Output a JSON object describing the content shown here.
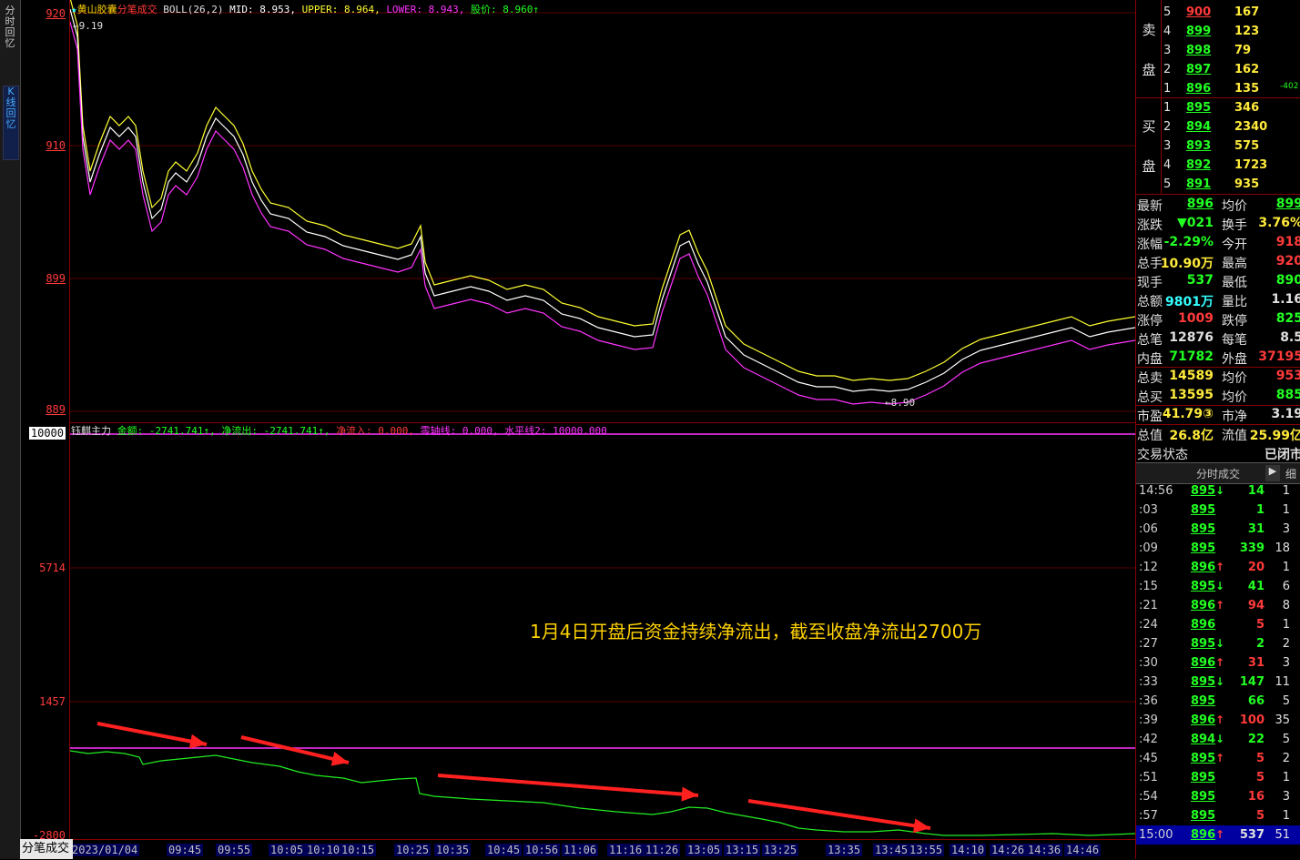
{
  "sidebar_tabs": [
    "分时回忆",
    "K线回忆"
  ],
  "upper_chart": {
    "legend": {
      "star": "★",
      "stock_name": "黄山胶囊",
      "mode": "分笔成交",
      "boll": "BOLL(26,2)",
      "mid": "MID: 8.953,",
      "upper": "UPPER: 8.964,",
      "lower": "LOWER: 8.943,",
      "price": "股价: 8.960↑"
    },
    "y_labels": [
      "920",
      "910",
      "899",
      "889"
    ],
    "high_mark": "9.19",
    "low_mark": "8.90"
  },
  "lower_chart": {
    "legend": {
      "name": "钰麒主力",
      "amount": "金额: -2741.741↑,",
      "net_out": "净流出: -2741.741↑,",
      "net_in": "净流入: 0.000,",
      "zero_line": "零轴线: 0.000,",
      "level2": "水平线2: 10000.000"
    },
    "y_labels": [
      "10000",
      "5714",
      "1457",
      "-2800"
    ],
    "annotation": "1月4日开盘后资金持续净流出，截至收盘净流出2700万"
  },
  "time_axis": [
    "2023/01/04",
    "09:45",
    "09:55",
    "10:05",
    "10:10",
    "10:15",
    "10:25",
    "10:35",
    "10:45",
    "10:56",
    "11:06",
    "11:16",
    "11:26",
    "13:05",
    "13:15",
    "13:25",
    "13:35",
    "13:45",
    "13:55",
    "14:10",
    "14:26",
    "14:36",
    "14:46"
  ],
  "bottom_tab": "分笔成交",
  "order_book": {
    "sell_label": [
      "卖",
      "盘"
    ],
    "buy_label": [
      "买",
      "盘"
    ],
    "sell": [
      {
        "lvl": "5",
        "price": "900",
        "vol": "167",
        "pc": "red"
      },
      {
        "lvl": "4",
        "price": "899",
        "vol": "123",
        "pc": "green"
      },
      {
        "lvl": "3",
        "price": "898",
        "vol": "79",
        "pc": "green"
      },
      {
        "lvl": "2",
        "price": "897",
        "vol": "162",
        "pc": "green"
      },
      {
        "lvl": "1",
        "price": "896",
        "vol": "135",
        "pc": "green",
        "delta": "-402"
      }
    ],
    "buy": [
      {
        "lvl": "1",
        "price": "895",
        "vol": "346",
        "pc": "green"
      },
      {
        "lvl": "2",
        "price": "894",
        "vol": "2340",
        "pc": "green"
      },
      {
        "lvl": "3",
        "price": "893",
        "vol": "575",
        "pc": "green"
      },
      {
        "lvl": "4",
        "price": "892",
        "vol": "1723",
        "pc": "green"
      },
      {
        "lvl": "5",
        "price": "891",
        "vol": "935",
        "pc": "green"
      }
    ]
  },
  "quote": [
    {
      "l": "最新",
      "v": "896",
      "vc": "green",
      "u": true,
      "l2": "均价",
      "v2": "899",
      "v2c": "green",
      "u2": true
    },
    {
      "l": "涨跌",
      "v": "▼021",
      "vc": "green",
      "l2": "换手",
      "v2": "3.76%",
      "v2c": "yellow"
    },
    {
      "l": "涨幅",
      "v": "-2.29%",
      "vc": "green",
      "l2": "今开",
      "v2": "918",
      "v2c": "red"
    },
    {
      "l": "总手",
      "v": "10.90万",
      "vc": "yellow",
      "l2": "最高",
      "v2": "920",
      "v2c": "red"
    },
    {
      "l": "现手",
      "v": "537",
      "vc": "green",
      "l2": "最低",
      "v2": "890",
      "v2c": "green"
    },
    {
      "l": "总额",
      "v": "9801万",
      "vc": "cyan",
      "l2": "量比",
      "v2": "1.16",
      "v2c": "white"
    },
    {
      "l": "涨停",
      "v": "1009",
      "vc": "red",
      "l2": "跌停",
      "v2": "825",
      "v2c": "green"
    },
    {
      "l": "总笔",
      "v": "12876",
      "vc": "white",
      "l2": "每笔",
      "v2": "8.5",
      "v2c": "white"
    },
    {
      "l": "内盘",
      "v": "71782",
      "vc": "green",
      "l2": "外盘",
      "v2": "37195",
      "v2c": "red"
    },
    {
      "l": "总卖",
      "v": "14589",
      "vc": "yellow",
      "l2": "均价",
      "v2": "953",
      "v2c": "red"
    },
    {
      "l": "总买",
      "v": "13595",
      "vc": "yellow",
      "l2": "均价",
      "v2": "885",
      "v2c": "green"
    },
    {
      "l": "市盈",
      "v": "41.79③",
      "vc": "yellow",
      "l2": "市净",
      "v2": "3.19",
      "v2c": "white"
    },
    {
      "l": "总值",
      "v": "26.8亿",
      "vc": "yellow",
      "l2": "流值",
      "v2": "25.99亿",
      "v2c": "yellow"
    },
    {
      "l": "交易状态",
      "v": "",
      "vc": "white",
      "l2": "",
      "v2": "已闭市",
      "v2c": "white"
    }
  ],
  "trades_header": {
    "title": "分时成交",
    "btn": "▶",
    "detail": "细"
  },
  "trades": [
    {
      "t": "14:56",
      "p": "895",
      "pc": "green",
      "a": "↓",
      "ac": "green",
      "v": "14",
      "vc": "green",
      "n": "1"
    },
    {
      "t": ":03",
      "p": "895",
      "pc": "green",
      "a": "",
      "ac": "",
      "v": "1",
      "vc": "green",
      "n": "1"
    },
    {
      "t": ":06",
      "p": "895",
      "pc": "green",
      "a": "",
      "ac": "",
      "v": "31",
      "vc": "green",
      "n": "3"
    },
    {
      "t": ":09",
      "p": "895",
      "pc": "green",
      "a": "",
      "ac": "",
      "v": "339",
      "vc": "green",
      "n": "18"
    },
    {
      "t": ":12",
      "p": "896",
      "pc": "green",
      "a": "↑",
      "ac": "red",
      "v": "20",
      "vc": "red",
      "n": "1"
    },
    {
      "t": ":15",
      "p": "895",
      "pc": "green",
      "a": "↓",
      "ac": "green",
      "v": "41",
      "vc": "green",
      "n": "6"
    },
    {
      "t": ":21",
      "p": "896",
      "pc": "green",
      "a": "↑",
      "ac": "red",
      "v": "94",
      "vc": "red",
      "n": "8"
    },
    {
      "t": ":24",
      "p": "896",
      "pc": "green",
      "a": "",
      "ac": "",
      "v": "5",
      "vc": "red",
      "n": "1"
    },
    {
      "t": ":27",
      "p": "895",
      "pc": "green",
      "a": "↓",
      "ac": "green",
      "v": "2",
      "vc": "green",
      "n": "2"
    },
    {
      "t": ":30",
      "p": "896",
      "pc": "green",
      "a": "↑",
      "ac": "red",
      "v": "31",
      "vc": "red",
      "n": "3"
    },
    {
      "t": ":33",
      "p": "895",
      "pc": "green",
      "a": "↓",
      "ac": "green",
      "v": "147",
      "vc": "green",
      "n": "11"
    },
    {
      "t": ":36",
      "p": "895",
      "pc": "green",
      "a": "",
      "ac": "",
      "v": "66",
      "vc": "green",
      "n": "5"
    },
    {
      "t": ":39",
      "p": "896",
      "pc": "green",
      "a": "↑",
      "ac": "red",
      "v": "100",
      "vc": "red",
      "n": "35"
    },
    {
      "t": ":42",
      "p": "894",
      "pc": "green",
      "a": "↓",
      "ac": "green",
      "v": "22",
      "vc": "green",
      "n": "5"
    },
    {
      "t": ":45",
      "p": "895",
      "pc": "green",
      "a": "↑",
      "ac": "red",
      "v": "5",
      "vc": "red",
      "n": "2"
    },
    {
      "t": ":51",
      "p": "895",
      "pc": "green",
      "a": "",
      "ac": "",
      "v": "5",
      "vc": "red",
      "n": "1"
    },
    {
      "t": ":54",
      "p": "895",
      "pc": "green",
      "a": "",
      "ac": "",
      "v": "16",
      "vc": "red",
      "n": "3"
    },
    {
      "t": ":57",
      "p": "895",
      "pc": "green",
      "a": "",
      "ac": "",
      "v": "5",
      "vc": "red",
      "n": "1"
    },
    {
      "t": "15:00",
      "p": "896",
      "pc": "green",
      "a": "↑",
      "ac": "red",
      "v": "537",
      "vc": "white",
      "n": "51"
    }
  ],
  "colors": {
    "up": "#ff3a3a",
    "down": "#22ff22",
    "mid": "#ffffff",
    "upper": "#ffff33",
    "lower": "#ff33ff",
    "flow": "#22ee22",
    "level": "#ff33ff",
    "arrow": "#ff2020"
  }
}
